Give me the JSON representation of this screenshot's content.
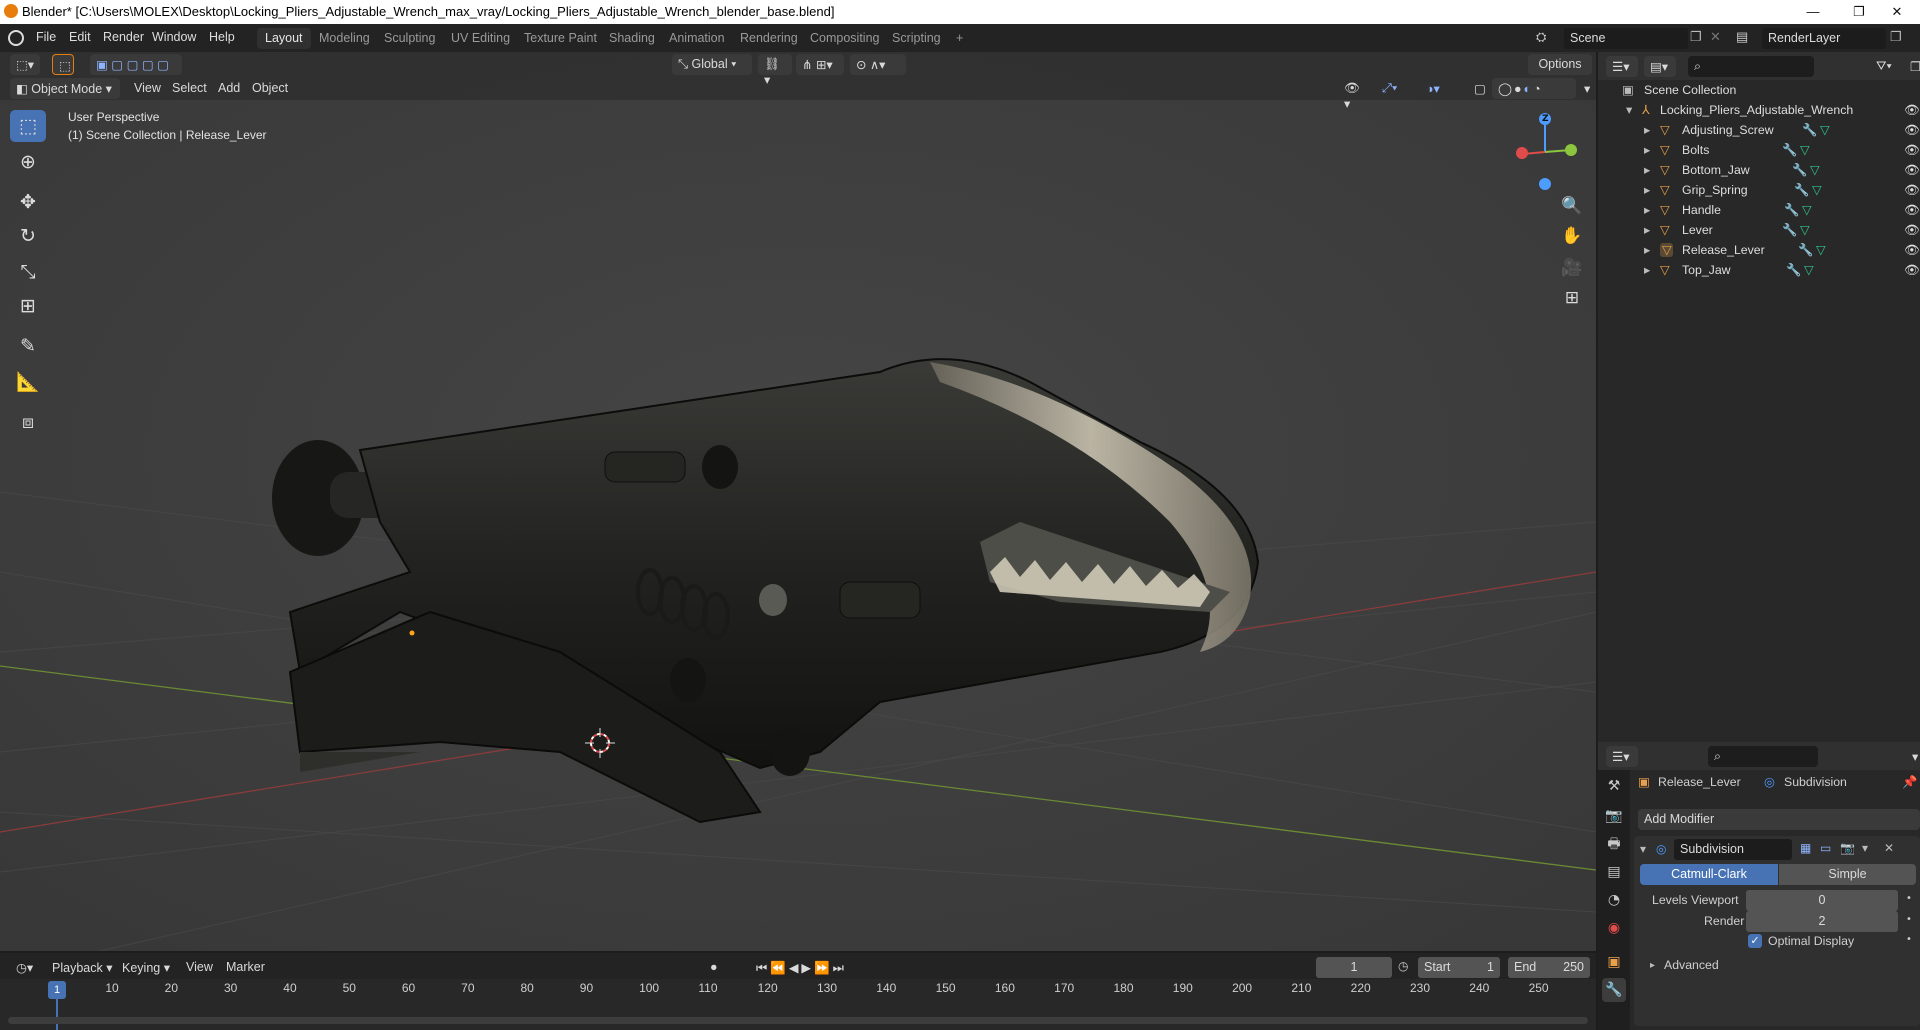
{
  "window": {
    "title": "Blender* [C:\\Users\\MOLEX\\Desktop\\Locking_Pliers_Adjustable_Wrench_max_vray/Locking_Pliers_Adjustable_Wrench_blender_base.blend]",
    "minimize": "—",
    "restore": "❐",
    "close": "✕"
  },
  "menubar": {
    "items": [
      "File",
      "Edit",
      "Render",
      "Window",
      "Help"
    ],
    "workspaces": [
      "Layout",
      "Modeling",
      "Sculpting",
      "UV Editing",
      "Texture Paint",
      "Shading",
      "Animation",
      "Rendering",
      "Compositing",
      "Scripting"
    ],
    "add_workspace": "+",
    "scene": "Scene",
    "view_layer": "RenderLayer"
  },
  "viewport": {
    "mode": "Object Mode",
    "menus": [
      "View",
      "Select",
      "Add",
      "Object"
    ],
    "orientation": "Global",
    "options_label": "Options",
    "overlay_line1": "User Perspective",
    "overlay_line2": "(1) Scene Collection | Release_Lever",
    "gizmo_z": "Z"
  },
  "outliner": {
    "root": "Scene Collection",
    "collection": "Locking_Pliers_Adjustable_Wrench",
    "objects": [
      "Adjusting_Screw",
      "Bolts",
      "Bottom_Jaw",
      "Grip_Spring",
      "Handle",
      "Lever",
      "Release_Lever",
      "Top_Jaw"
    ],
    "selected": "Release_Lever"
  },
  "properties": {
    "object_name": "Release_Lever",
    "modifier_context": "Subdivision",
    "add_modifier": "Add Modifier",
    "modifier": {
      "name": "Subdivision",
      "types": [
        "Catmull-Clark",
        "Simple"
      ],
      "active_type": "Catmull-Clark",
      "levels_viewport_label": "Levels Viewport",
      "levels_viewport": "0",
      "render_label": "Render",
      "render": "2",
      "optimal_display_label": "Optimal Display",
      "optimal_display": true,
      "advanced_label": "Advanced"
    }
  },
  "timeline": {
    "menus": [
      "Playback",
      "Keying",
      "View",
      "Marker"
    ],
    "current_frame": "1",
    "start_label": "Start",
    "start": "1",
    "end_label": "End",
    "end": "250",
    "ticks": [
      "1",
      "10",
      "20",
      "30",
      "40",
      "50",
      "60",
      "70",
      "80",
      "90",
      "100",
      "110",
      "120",
      "130",
      "140",
      "150",
      "160",
      "170",
      "180",
      "190",
      "200",
      "210",
      "220",
      "230",
      "240",
      "250"
    ]
  },
  "colors": {
    "accent": "#4772b3",
    "blender_orange": "#e87d0d",
    "axis_x": "#e04b4b",
    "axis_y": "#8cc63f",
    "axis_z": "#4d9cff"
  }
}
